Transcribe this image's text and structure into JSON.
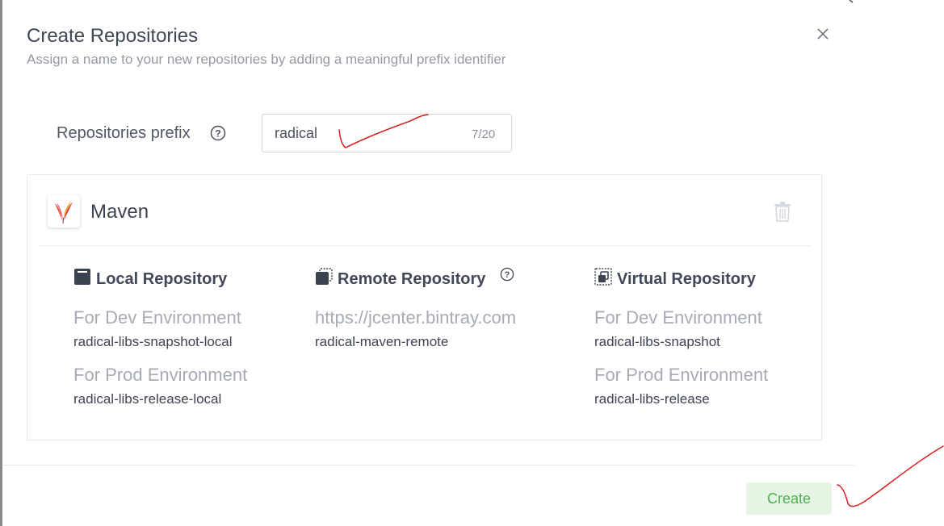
{
  "dialog": {
    "title": "Create Repositories",
    "subtitle": "Assign a name to your new repositories by adding a meaningful prefix identifier"
  },
  "prefix": {
    "label": "Repositories prefix",
    "value": "radical",
    "counter": "7/20"
  },
  "package": {
    "name": "Maven",
    "logo_icon": "apache-feather-icon",
    "columns": [
      {
        "icon": "local-repo-icon",
        "title": "Local Repository",
        "entries": [
          {
            "env": "For Dev Environment",
            "repo": "radical-libs-snapshot-local"
          },
          {
            "env": "For Prod Environment",
            "repo": "radical-libs-release-local"
          }
        ]
      },
      {
        "icon": "remote-repo-icon",
        "title": "Remote Repository",
        "entries": [
          {
            "env": "https://jcenter.bintray.com",
            "repo": "radical-maven-remote"
          }
        ]
      },
      {
        "icon": "virtual-repo-icon",
        "title": "Virtual Repository",
        "entries": [
          {
            "env": "For Dev Environment",
            "repo": "radical-libs-snapshot"
          },
          {
            "env": "For Prod Environment",
            "repo": "radical-libs-release"
          }
        ]
      }
    ]
  },
  "footer": {
    "create_label": "Create"
  },
  "colors": {
    "create_bg": "#e6f4e4",
    "create_text": "#4caf50",
    "annotation": "#d42020"
  }
}
